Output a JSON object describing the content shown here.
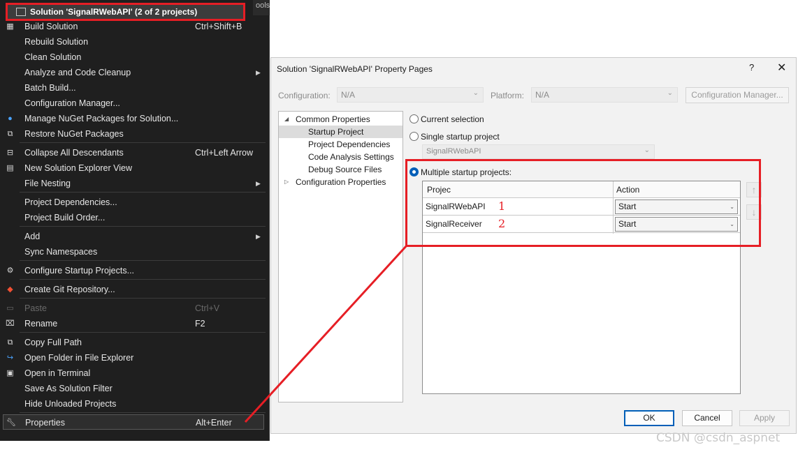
{
  "context_menu": {
    "header": "Solution 'SignalRWebAPI' (2 of 2 projects)",
    "side_tab": "ools",
    "items": [
      {
        "label": "Build Solution",
        "shortcut": "Ctrl+Shift+B",
        "icon": "build-icon"
      },
      {
        "label": "Rebuild Solution"
      },
      {
        "label": "Clean Solution"
      },
      {
        "label": "Analyze and Code Cleanup",
        "submenu": true
      },
      {
        "label": "Batch Build..."
      },
      {
        "label": "Configuration Manager..."
      },
      {
        "label": "Manage NuGet Packages for Solution...",
        "icon": "nuget-icon"
      },
      {
        "label": "Restore NuGet Packages",
        "icon": "restore-icon"
      },
      {
        "label": "Collapse All Descendants",
        "shortcut": "Ctrl+Left Arrow",
        "icon": "collapse-icon"
      },
      {
        "label": "New Solution Explorer View",
        "icon": "new-view-icon"
      },
      {
        "label": "File Nesting",
        "submenu": true
      },
      {
        "label": "Project Dependencies..."
      },
      {
        "label": "Project Build Order..."
      },
      {
        "label": "Add",
        "submenu": true
      },
      {
        "label": "Sync Namespaces"
      },
      {
        "label": "Configure Startup Projects...",
        "icon": "gear-icon"
      },
      {
        "label": "Create Git Repository...",
        "icon": "git-icon"
      },
      {
        "label": "Paste",
        "shortcut": "Ctrl+V",
        "disabled": true,
        "icon": "paste-icon"
      },
      {
        "label": "Rename",
        "shortcut": "F2",
        "icon": "rename-icon"
      },
      {
        "label": "Copy Full Path",
        "icon": "copy-icon"
      },
      {
        "label": "Open Folder in File Explorer",
        "icon": "open-folder-icon"
      },
      {
        "label": "Open in Terminal",
        "icon": "terminal-icon"
      },
      {
        "label": "Save As Solution Filter"
      },
      {
        "label": "Hide Unloaded Projects"
      },
      {
        "label": "Properties",
        "shortcut": "Alt+Enter",
        "highlighted": true,
        "icon": "wrench-icon"
      }
    ]
  },
  "dialog": {
    "title": "Solution 'SignalRWebAPI' Property Pages",
    "help": "?",
    "close": "✕",
    "configuration_label": "Configuration:",
    "configuration_value": "N/A",
    "platform_label": "Platform:",
    "platform_value": "N/A",
    "config_manager_button": "Configuration Manager...",
    "tree": {
      "common_properties": "Common Properties",
      "startup_project": "Startup Project",
      "project_dependencies": "Project Dependencies",
      "code_analysis_settings": "Code Analysis Settings",
      "debug_source_files": "Debug Source Files",
      "configuration_properties": "Configuration Properties"
    },
    "radio_current": "Current selection",
    "radio_single": "Single startup project",
    "single_project_value": "SignalRWebAPI",
    "radio_multiple": "Multiple startup projects:",
    "grid": {
      "col_project": "Projec",
      "col_action": "Action",
      "rows": [
        {
          "project": "SignalRWebAPI",
          "action": "Start",
          "annotation": "1"
        },
        {
          "project": "SignalReceiver",
          "action": "Start",
          "annotation": "2"
        }
      ]
    },
    "move_up": "↑",
    "move_down": "↓",
    "ok": "OK",
    "cancel": "Cancel",
    "apply": "Apply"
  },
  "watermark": "CSDN @csdn_aspnet",
  "colors": {
    "menu_bg": "#1f1f1f",
    "dialog_bg": "#f2f2f2",
    "accent": "#005fb8",
    "annotation_red": "#e61e25"
  }
}
